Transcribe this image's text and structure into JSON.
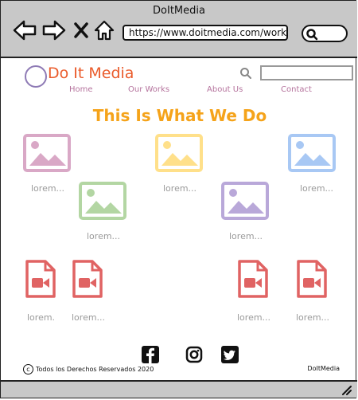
{
  "browser": {
    "title": "DoItMedia",
    "url": "https://www.doitmedia.com/work"
  },
  "site": {
    "brand": "Do It Media",
    "nav": [
      "Home",
      "Our Works",
      "About Us",
      "Contact"
    ],
    "search_placeholder": ""
  },
  "main": {
    "heading": "This  Is What We Do",
    "images": [
      {
        "color": "#d9a8c6",
        "caption": "lorem..."
      },
      {
        "color": "#ffe08a",
        "caption": "lorem..."
      },
      {
        "color": "#a8c8f4",
        "caption": "lorem..."
      },
      {
        "color": "#b3d6a3",
        "caption": "lorem..."
      },
      {
        "color": "#b9a8d9",
        "caption": "lorem..."
      }
    ],
    "videos": [
      {
        "caption": "lorem."
      },
      {
        "caption": "lorem..."
      },
      {
        "caption": "lorem..."
      },
      {
        "caption": "lorem..."
      }
    ]
  },
  "footer": {
    "copyright": "Todos los Derechos Reservados 2020",
    "brand": "DoItMedia",
    "social": [
      "facebook-icon",
      "instagram-icon",
      "twitter-icon"
    ]
  },
  "colors": {
    "brand": "#ea5b2b",
    "nav": "#b5739d",
    "heading": "#f5a31a",
    "video": "#e06363",
    "chrome": "#c8c8c8"
  }
}
